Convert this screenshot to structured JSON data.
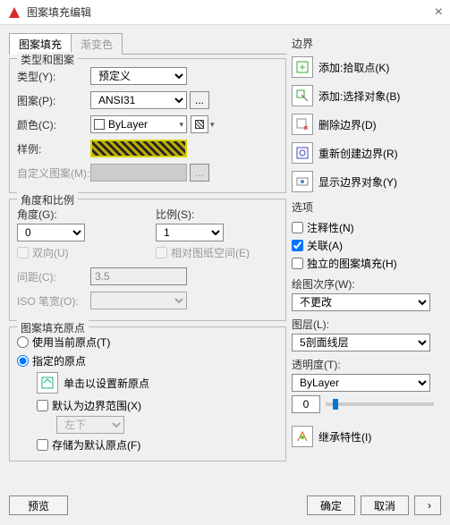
{
  "window": {
    "title": "图案填充编辑",
    "close": "×"
  },
  "tabs": {
    "hatch": "图案填充",
    "gradient": "渐变色"
  },
  "typePattern": {
    "title": "类型和图案",
    "typeLbl": "类型(Y):",
    "typeVal": "预定义",
    "patternLbl": "图案(P):",
    "patternVal": "ANSI31",
    "colorLbl": "颜色(C):",
    "colorVal": "ByLayer",
    "sampleLbl": "样例:",
    "customLbl": "自定义图案(M):"
  },
  "angleScale": {
    "title": "角度和比例",
    "angleLbl": "角度(G):",
    "angleVal": "0",
    "scaleLbl": "比例(S):",
    "scaleVal": "1",
    "bidirLbl": "双向(U)",
    "relPaperLbl": "相对图纸空间(E)",
    "spacingLbl": "间距(C):",
    "spacingVal": "3.5",
    "isoLbl": "ISO 笔宽(O):"
  },
  "origin": {
    "title": "图案填充原点",
    "useCurrentLbl": "使用当前原点(T)",
    "specifiedLbl": "指定的原点",
    "clickSetLbl": "单击以设置新原点",
    "defaultBoundLbl": "默认为边界范围(X)",
    "posVal": "左下",
    "storeDefaultLbl": "存储为默认原点(F)"
  },
  "boundary": {
    "title": "边界",
    "addPickLbl": "添加:拾取点(K)",
    "addSelLbl": "添加:选择对象(B)",
    "removeLbl": "删除边界(D)",
    "recreateLbl": "重新创建边界(R)",
    "showBoundLbl": "显示边界对象(Y)"
  },
  "options": {
    "title": "选项",
    "annotLbl": "注释性(N)",
    "assocLbl": "关联(A)",
    "indepLbl": "独立的图案填充(H)",
    "drawOrderLbl": "绘图次序(W):",
    "drawOrderVal": "不更改",
    "layerLbl": "图层(L):",
    "layerVal": "5剖面线层",
    "transpLbl": "透明度(T):",
    "transpVal": "ByLayer",
    "transpNum": "0",
    "inheritLbl": "继承特性(I)"
  },
  "footer": {
    "preview": "预览",
    "ok": "确定",
    "cancel": "取消",
    "expand": "›"
  }
}
